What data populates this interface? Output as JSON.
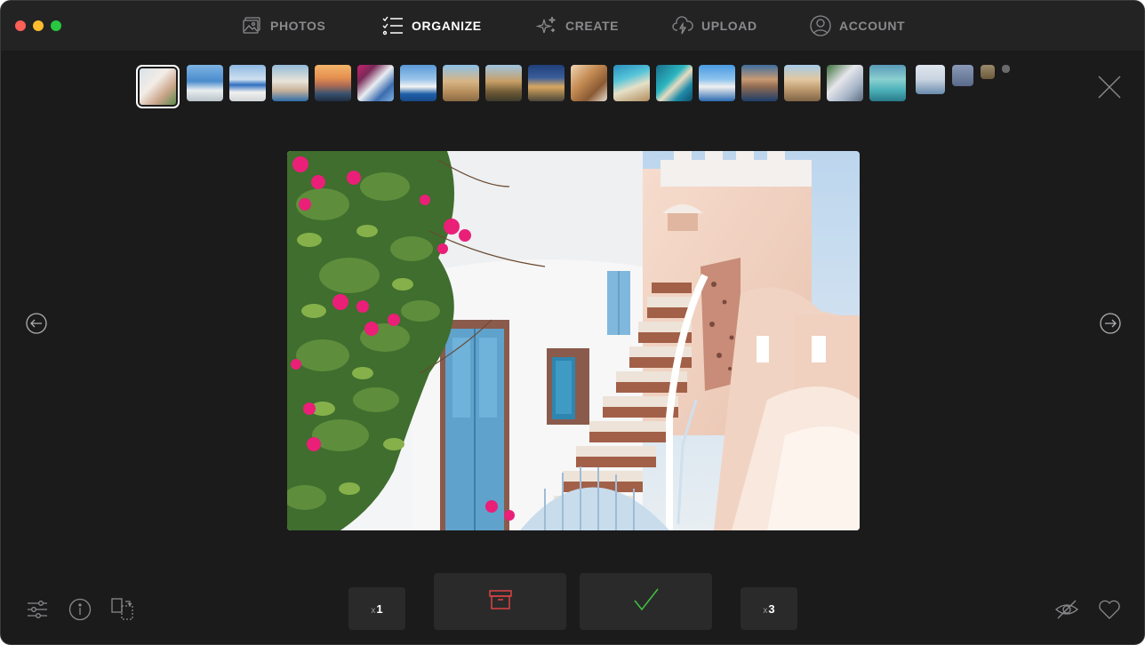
{
  "window": {
    "title": ""
  },
  "nav": {
    "photos": "PHOTOS",
    "organize": "ORGANIZE",
    "create": "CREATE",
    "upload": "UPLOAD",
    "account": "ACCOUNT",
    "active": "organize"
  },
  "filmstrip": {
    "selected_index": 0,
    "thumbnails": [
      {
        "icon": "santorini-stairs-thumb"
      },
      {
        "icon": "sea-bay-thumb"
      },
      {
        "icon": "blue-domes-thumb"
      },
      {
        "icon": "oia-village-thumb"
      },
      {
        "icon": "sunset-coast-thumb"
      },
      {
        "icon": "flowers-church-thumb"
      },
      {
        "icon": "pool-view-thumb"
      },
      {
        "icon": "parthenon-thumb"
      },
      {
        "icon": "acropolis-thumb"
      },
      {
        "icon": "temple-night-thumb"
      },
      {
        "icon": "cafe-thumb"
      },
      {
        "icon": "turquoise-beach-thumb"
      },
      {
        "icon": "navagio-beach-thumb"
      },
      {
        "icon": "windmill-thumb"
      },
      {
        "icon": "cliff-town-thumb"
      },
      {
        "icon": "parthenon-columns-thumb"
      },
      {
        "icon": "alley-thumb"
      },
      {
        "icon": "lagoon-thumb"
      },
      {
        "icon": "harbor-thumb"
      },
      {
        "icon": "mini-1-thumb"
      },
      {
        "icon": "mini-2-thumb"
      },
      {
        "icon": "mini-3-thumb"
      }
    ]
  },
  "actions": {
    "reject_one": {
      "x": "x",
      "count": "1"
    },
    "keep_three": {
      "x": "x",
      "count": "3"
    },
    "archive_icon": "archive-box-icon",
    "keep_icon": "check-icon"
  },
  "colors": {
    "background": "#1b1b1c",
    "titlebar": "#232324",
    "button": "#2a2a2b",
    "archive_red": "#e84545",
    "check_green": "#3fbf3f",
    "nav_inactive": "#8a8a8d"
  }
}
